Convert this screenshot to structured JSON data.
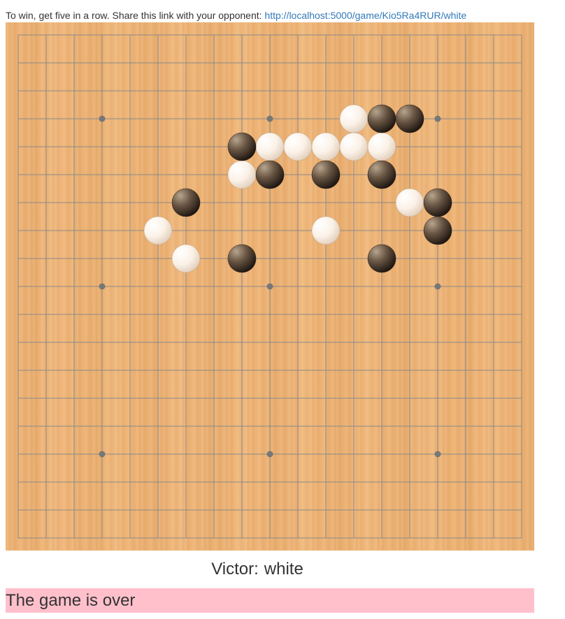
{
  "intro": {
    "text": "To win, get five in a row. Share this link with your opponent:",
    "link": "http://localhost:5000/game/Kio5Ra4RUR/white"
  },
  "board": {
    "size": 19,
    "star_points": [
      [
        3,
        3
      ],
      [
        9,
        3
      ],
      [
        15,
        3
      ],
      [
        3,
        9
      ],
      [
        9,
        9
      ],
      [
        15,
        9
      ],
      [
        3,
        15
      ],
      [
        9,
        15
      ],
      [
        15,
        15
      ]
    ],
    "white_stones": [
      [
        12,
        3
      ],
      [
        9,
        4
      ],
      [
        10,
        4
      ],
      [
        11,
        4
      ],
      [
        12,
        4
      ],
      [
        13,
        4
      ],
      [
        8,
        5
      ],
      [
        14,
        6
      ],
      [
        5,
        7
      ],
      [
        11,
        7
      ],
      [
        6,
        8
      ]
    ],
    "black_stones": [
      [
        13,
        3
      ],
      [
        14,
        3
      ],
      [
        8,
        4
      ],
      [
        9,
        5
      ],
      [
        11,
        5
      ],
      [
        13,
        5
      ],
      [
        6,
        6
      ],
      [
        15,
        6
      ],
      [
        15,
        7
      ],
      [
        8,
        8
      ],
      [
        13,
        8
      ]
    ],
    "colors": {
      "line": "#8a8a8a",
      "wood": "#eeb375",
      "star": "#777777"
    }
  },
  "victor": {
    "label": "Victor:",
    "value": "white"
  },
  "status": {
    "text": "The game is over",
    "color": "#ffc0cb"
  }
}
